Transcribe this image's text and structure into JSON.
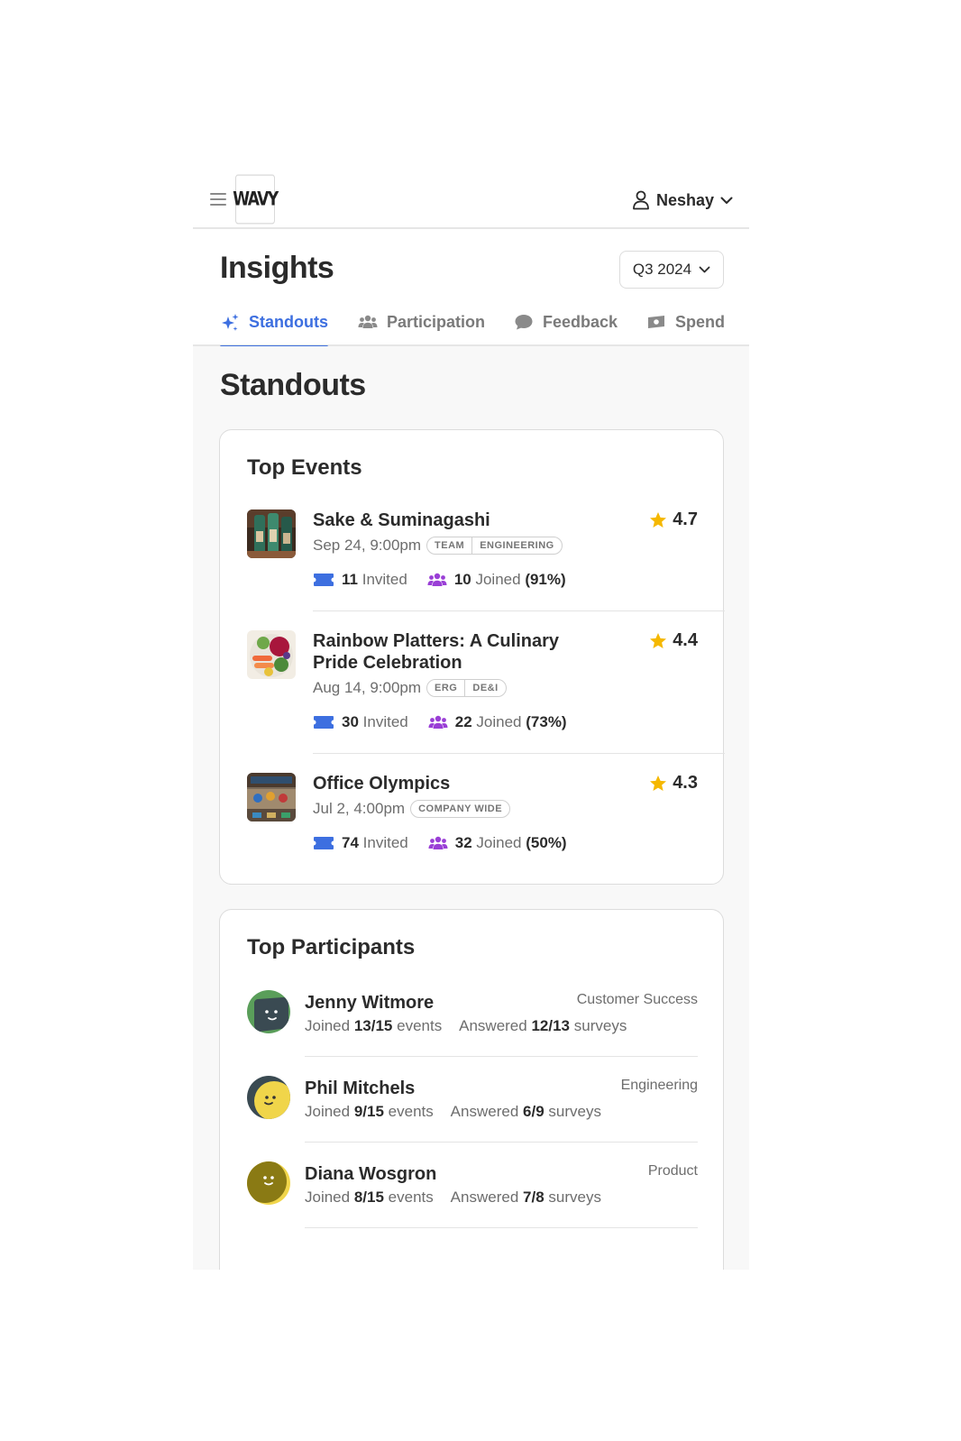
{
  "app": {
    "logo_text": "WAVY",
    "user_name": "Neshay"
  },
  "header": {
    "title": "Insights",
    "period": "Q3 2024"
  },
  "tabs": [
    {
      "label": "Standouts",
      "icon": "sparkle-icon",
      "active": true
    },
    {
      "label": "Participation",
      "icon": "people-icon",
      "active": false
    },
    {
      "label": "Feedback",
      "icon": "chat-bubble-icon",
      "active": false
    },
    {
      "label": "Spend",
      "icon": "money-icon",
      "active": false
    }
  ],
  "section_title": "Standouts",
  "top_events": {
    "title": "Top Events",
    "events": [
      {
        "name": "Sake & Suminagashi",
        "rating": "4.7",
        "date": "Sep 24, 9:00pm",
        "tags": [
          "TEAM",
          "ENGINEERING"
        ],
        "invited": "11",
        "invited_label": "Invited",
        "joined": "10",
        "joined_label": "Joined",
        "joined_pct": "(91%)"
      },
      {
        "name": "Rainbow Platters: A Culinary Pride Celebration",
        "rating": "4.4",
        "date": "Aug 14, 9:00pm",
        "tags": [
          "ERG",
          "DE&I"
        ],
        "invited": "30",
        "invited_label": "Invited",
        "joined": "22",
        "joined_label": "Joined",
        "joined_pct": "(73%)"
      },
      {
        "name": "Office Olympics",
        "rating": "4.3",
        "date": "Jul 2, 4:00pm",
        "tags": [
          "COMPANY WIDE"
        ],
        "invited": "74",
        "invited_label": "Invited",
        "joined": "32",
        "joined_label": "Joined",
        "joined_pct": "(50%)"
      }
    ]
  },
  "top_participants": {
    "title": "Top Participants",
    "joined_label": "Joined",
    "events_label": "events",
    "answered_label": "Answered",
    "surveys_label": "surveys",
    "people": [
      {
        "name": "Jenny Witmore",
        "department": "Customer Success",
        "joined": "13/15",
        "answered": "12/13"
      },
      {
        "name": "Phil Mitchels",
        "department": "Engineering",
        "joined": "9/15",
        "answered": "6/9"
      },
      {
        "name": "Diana Wosgron",
        "department": "Product",
        "joined": "8/15",
        "answered": "7/8"
      }
    ]
  },
  "colors": {
    "accent": "#3d6fe0",
    "star": "#f5b800",
    "ticket": "#3d6fe0",
    "people": "#9a3fd6"
  }
}
